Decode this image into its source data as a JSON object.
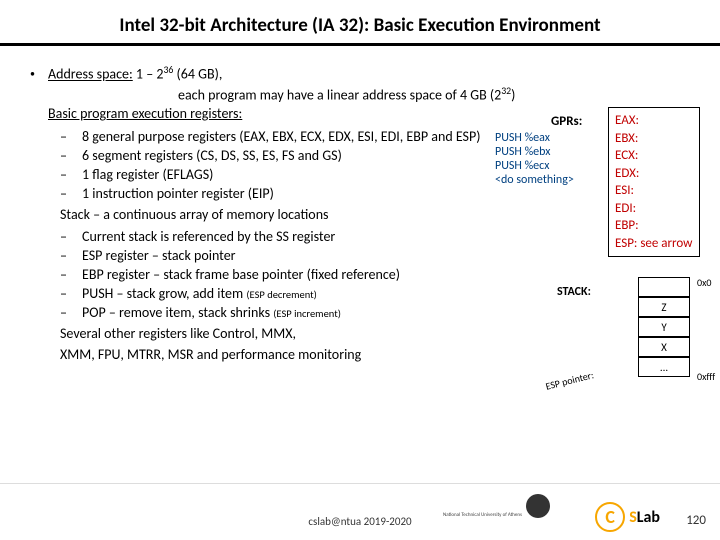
{
  "title": "Intel 32-bit Architecture (IA 32): Basic Execution Environment",
  "main": {
    "address_space_label": "Address space:",
    "address_space_value_pre": " 1 – 2",
    "address_space_exp1": "36",
    "address_space_value_post": " (64 GB),",
    "address_space_line2_pre": "each program may have a linear address space of 4 GB (2",
    "address_space_exp2": "32",
    "address_space_line2_post": ")",
    "basic_registers_label": "Basic program execution registers:"
  },
  "sub1": [
    "8 general purpose registers (EAX, EBX, ECX, EDX, ESI, EDI, EBP and ESP)",
    "6 segment registers (CS, DS, SS, ES, FS and GS)",
    "1 flag register (EFLAGS)",
    "1 instruction pointer register (EIP)"
  ],
  "stack_heading": "Stack – a continuous array of memory locations",
  "sub2": [
    {
      "t": "Current stack is referenced by the SS register",
      "s": ""
    },
    {
      "t": "ESP register – stack pointer",
      "s": ""
    },
    {
      "t": "EBP register – stack frame base pointer (fixed reference)",
      "s": ""
    },
    {
      "t": "PUSH – stack grow, add item ",
      "s": "(ESP decrement)"
    },
    {
      "t": "POP – remove item, stack shrinks ",
      "s": "(ESP increment)"
    }
  ],
  "other_regs_l1": "Several other registers like Control, MMX,",
  "other_regs_l2": "XMM, FPU, MTRR, MSR and performance monitoring",
  "gprs_label": "GPRs:",
  "push_lines": [
    "PUSH %eax",
    "PUSH %ebx",
    "PUSH %ecx",
    "<do something>"
  ],
  "reg_list": [
    "EAX:",
    "EBX:",
    "ECX:",
    "EDX:",
    "ESI:",
    "EDI:",
    "EBP:",
    "ESP: see arrow"
  ],
  "stack_label": "STACK:",
  "stack_cells": [
    "",
    "Z",
    "Y",
    "X",
    "..."
  ],
  "stack_hex_top": "0x0",
  "stack_hex_bot": "0xfff",
  "esp_pointer": "ESP pointer:",
  "footer": "cslab@ntua 2019-2020",
  "page": "120",
  "logo_c": "C",
  "logo_text_s": "S",
  "logo_text_rest": "Lab",
  "seal_label": "National Technical\nUniversity of Athens"
}
